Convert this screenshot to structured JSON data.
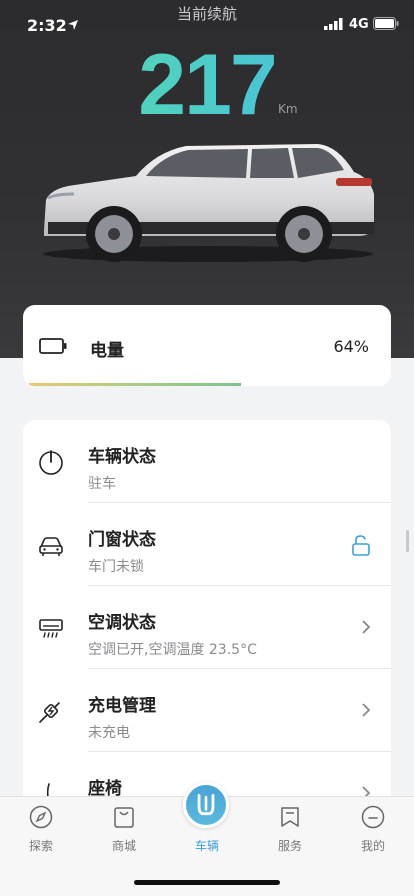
{
  "status_bar": {
    "time": "2:32",
    "network": "4G"
  },
  "hero": {
    "title": "当前续航",
    "range_value": "217",
    "range_unit": "Km"
  },
  "battery": {
    "label": "电量",
    "percent_text": "64%",
    "level": 0.64
  },
  "rows": [
    {
      "title": "车辆状态",
      "subtitle": "驻车",
      "icon": "power-icon",
      "action": "none"
    },
    {
      "title": "门窗状态",
      "subtitle": "车门未锁",
      "icon": "car-front-icon",
      "action": "unlock-icon"
    },
    {
      "title": "空调状态",
      "subtitle": "空调已开,空调温度 23.5°C",
      "icon": "air-conditioner-icon",
      "action": "chevron-right-icon"
    },
    {
      "title": "充电管理",
      "subtitle": "未充电",
      "icon": "charging-plug-icon",
      "action": "chevron-right-icon"
    },
    {
      "title": "座椅",
      "subtitle": "",
      "icon": "seat-icon",
      "action": "chevron-right-icon"
    }
  ],
  "tabs": [
    {
      "label": "探索",
      "icon": "compass-icon"
    },
    {
      "label": "商城",
      "icon": "shopping-bag-icon"
    },
    {
      "label": "车辆",
      "icon": "vehicle-logo-icon",
      "active": true
    },
    {
      "label": "服务",
      "icon": "bookmark-icon"
    },
    {
      "label": "我的",
      "icon": "smiley-icon"
    }
  ],
  "colors": {
    "accent": "#3f9fd3",
    "range_gradient_start": "#5be0a4",
    "range_gradient_end": "#48b7e2",
    "hero_bg": "#2e2e31"
  }
}
